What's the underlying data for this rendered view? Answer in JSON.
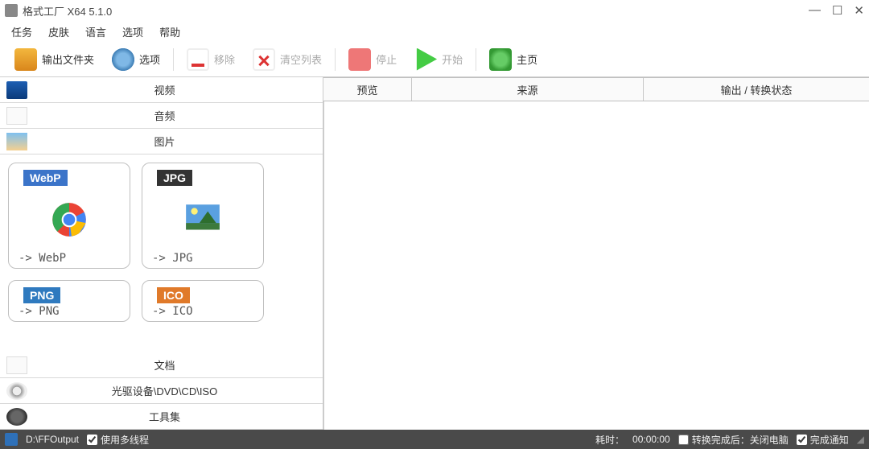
{
  "window": {
    "title": "格式工厂 X64 5.1.0"
  },
  "menu": {
    "task": "任务",
    "skin": "皮肤",
    "language": "语言",
    "options": "选项",
    "help": "帮助"
  },
  "toolbar": {
    "output_folder": "输出文件夹",
    "options": "选项",
    "remove": "移除",
    "clear": "清空列表",
    "stop": "停止",
    "start": "开始",
    "home": "主页"
  },
  "categories": {
    "video": "视频",
    "audio": "音频",
    "image": "图片",
    "document": "文档",
    "disc": "光驱设备\\DVD\\CD\\ISO",
    "tools": "工具集"
  },
  "tiles": [
    {
      "badge": "WebP",
      "label": "-> WebP",
      "badgeClass": "bdg-webp"
    },
    {
      "badge": "JPG",
      "label": "-> JPG",
      "badgeClass": "bdg-jpg"
    },
    {
      "badge": "PNG",
      "label": "-> PNG",
      "badgeClass": "bdg-png"
    },
    {
      "badge": "ICO",
      "label": "-> ICO",
      "badgeClass": "bdg-ico"
    }
  ],
  "table": {
    "preview": "预览",
    "source": "来源",
    "output_status": "输出 / 转换状态"
  },
  "status": {
    "output_path": "D:\\FFOutput",
    "multithread_label": "使用多线程",
    "multithread_checked": true,
    "elapsed_label": "耗时：",
    "elapsed_value": "00:00:00",
    "after_convert_label": "转换完成后：关闭电脑",
    "after_convert_checked": false,
    "notify_label": "完成通知",
    "notify_checked": true
  }
}
